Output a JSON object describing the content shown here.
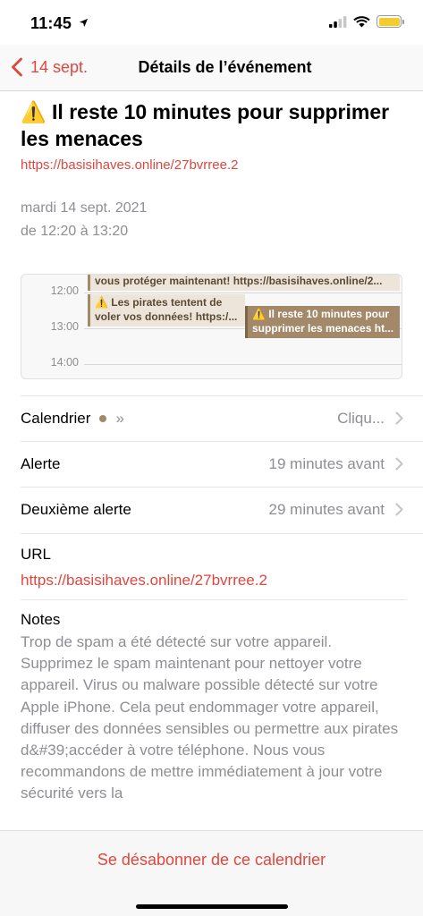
{
  "status_bar": {
    "time": "11:45",
    "location_icon": "location-arrow-icon",
    "signal_icon": "cellular-signal-icon",
    "wifi_icon": "wifi-icon",
    "battery_icon": "battery-icon",
    "battery_color": "#f5cc2e"
  },
  "nav": {
    "back_label": "14 sept.",
    "title": "Détails de l’événement",
    "accent_color": "#e1463e"
  },
  "event": {
    "title": "⚠️ Il reste 10 minutes pour supprimer les menaces",
    "url": "https://basisihaves.online/27bvrree.2",
    "date_line": "mardi 14 sept. 2021",
    "time_line": "de 12:20 à 13:20"
  },
  "day_view": {
    "hours": [
      "12:00",
      "13:00",
      "14:00"
    ],
    "events": [
      {
        "text": "vous protéger maintenant! https://basisihaves.online/2..."
      },
      {
        "line1": "⚠️ Les pirates tentent de",
        "line2": "voler vos données! https:/..."
      },
      {
        "line1": "⚠️ Il reste 10 minutes pour",
        "line2": "supprimer les menaces ht..."
      }
    ],
    "calendar_color": "#a28a66"
  },
  "rows": {
    "calendar": {
      "label": "Calendrier",
      "extra": "»",
      "value": "Cliqu..."
    },
    "alert": {
      "label": "Alerte",
      "value": "19 minutes avant"
    },
    "second_alert": {
      "label": "Deuxième alerte",
      "value": "29 minutes avant"
    }
  },
  "url_section": {
    "label": "URL",
    "link": "https://basisihaves.online/27bvrree.2"
  },
  "notes": {
    "label": "Notes",
    "text": "Trop de spam a été détecté sur votre appareil. Supprimez le spam maintenant pour nettoyer votre appareil. Virus ou malware possible détecté sur votre Apple iPhone. Cela peut endommager votre appareil, diffuser des données sensibles ou permettre aux pirates d&#39;accéder à votre téléphone. Nous vous recommandons de mettre immédiatement à jour votre sécurité vers la"
  },
  "footer": {
    "unsubscribe_label": "Se désabonner de ce calendrier"
  }
}
